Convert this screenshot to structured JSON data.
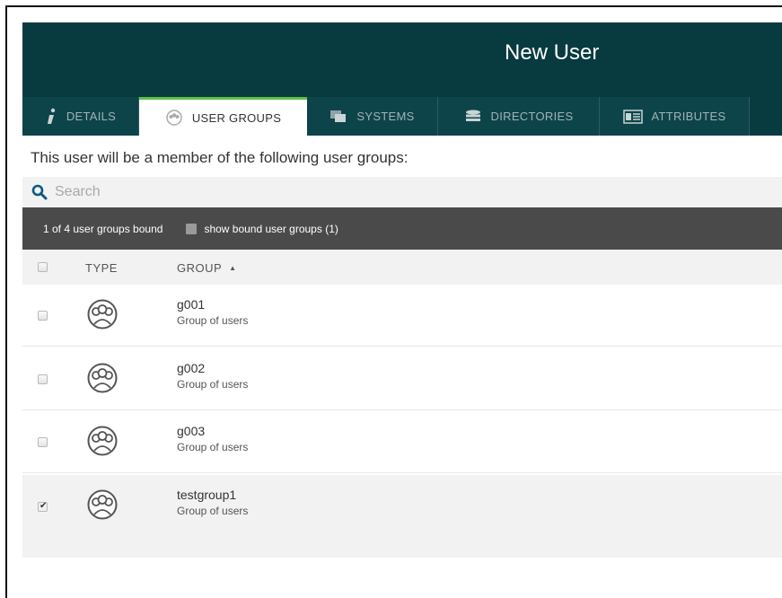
{
  "header": {
    "title": "New User"
  },
  "tabs": [
    {
      "label": "DETAILS",
      "icon": "info-icon",
      "active": false
    },
    {
      "label": "USER GROUPS",
      "icon": "user-group-icon",
      "active": true
    },
    {
      "label": "SYSTEMS",
      "icon": "systems-icon",
      "active": false
    },
    {
      "label": "DIRECTORIES",
      "icon": "directories-icon",
      "active": false
    },
    {
      "label": "ATTRIBUTES",
      "icon": "attributes-icon",
      "active": false
    }
  ],
  "main": {
    "subtitle": "This user will be a member of the following user groups:",
    "search": {
      "placeholder": "Search",
      "value": ""
    },
    "status": {
      "count_text": "1 of 4 user groups bound",
      "show_bound_label": "show bound user groups (1)",
      "show_bound_checked": false
    },
    "columns": {
      "type": "TYPE",
      "group": "GROUP",
      "sort_indicator": "▲"
    },
    "rows": [
      {
        "name": "g001",
        "description": "Group of users",
        "checked": false
      },
      {
        "name": "g002",
        "description": "Group of users",
        "checked": false
      },
      {
        "name": "g003",
        "description": "Group of users",
        "checked": false
      },
      {
        "name": "testgroup1",
        "description": "Group of users",
        "checked": true
      }
    ]
  },
  "colors": {
    "header_bg": "#073b40",
    "tab_active_accent": "#5ec04a",
    "status_bar_bg": "#4a4a4a",
    "search_icon": "#0b5a82"
  }
}
